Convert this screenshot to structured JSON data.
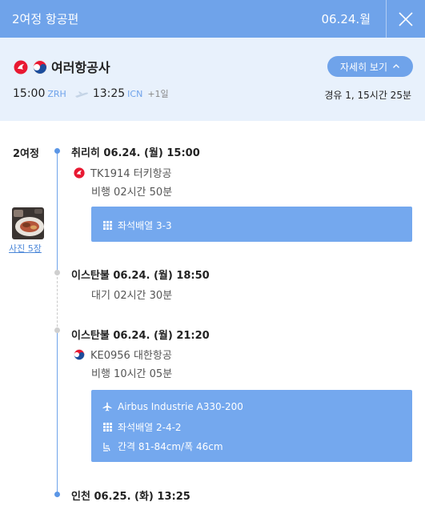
{
  "header": {
    "title": "2여정 항공편",
    "date": "06.24.월",
    "close_icon": "close-icon"
  },
  "summary": {
    "airline_name": "여러항공사",
    "detail_button": "자세히 보기",
    "depart_time": "15:00",
    "depart_code": "ZRH",
    "arrive_time": "13:25",
    "arrive_code": "ICN",
    "day_offset": "+1일",
    "duration": "경유 1, 15시간 25분"
  },
  "leg": {
    "label": "2여정",
    "photo_link": "사진 5장"
  },
  "stops": [
    {
      "title": "취리히 06.24. (월) 15:00"
    },
    {
      "title": "이스탄불 06.24. (월) 18:50",
      "wait": "대기 02시간 30분"
    },
    {
      "title": "이스탄불 06.24. (월) 21:20"
    },
    {
      "title": "인천 06.25. (화) 13:25"
    }
  ],
  "flights": [
    {
      "code": "TK1914 터키항공",
      "duration": "비행 02시간 50분",
      "seat": "좌석배열 3-3"
    },
    {
      "code": "KE0956 대한항공",
      "duration": "비행 10시간 05분",
      "aircraft": "Airbus Industrie A330-200",
      "seat": "좌석배열 2-4-2",
      "pitch": "간격 81-84cm/폭 46cm"
    }
  ],
  "colors": {
    "accent": "#6fa3ea",
    "summary_bg": "#e8f1fc",
    "turkish_red": "#e81932",
    "korean_blue": "#1c4d9c"
  }
}
